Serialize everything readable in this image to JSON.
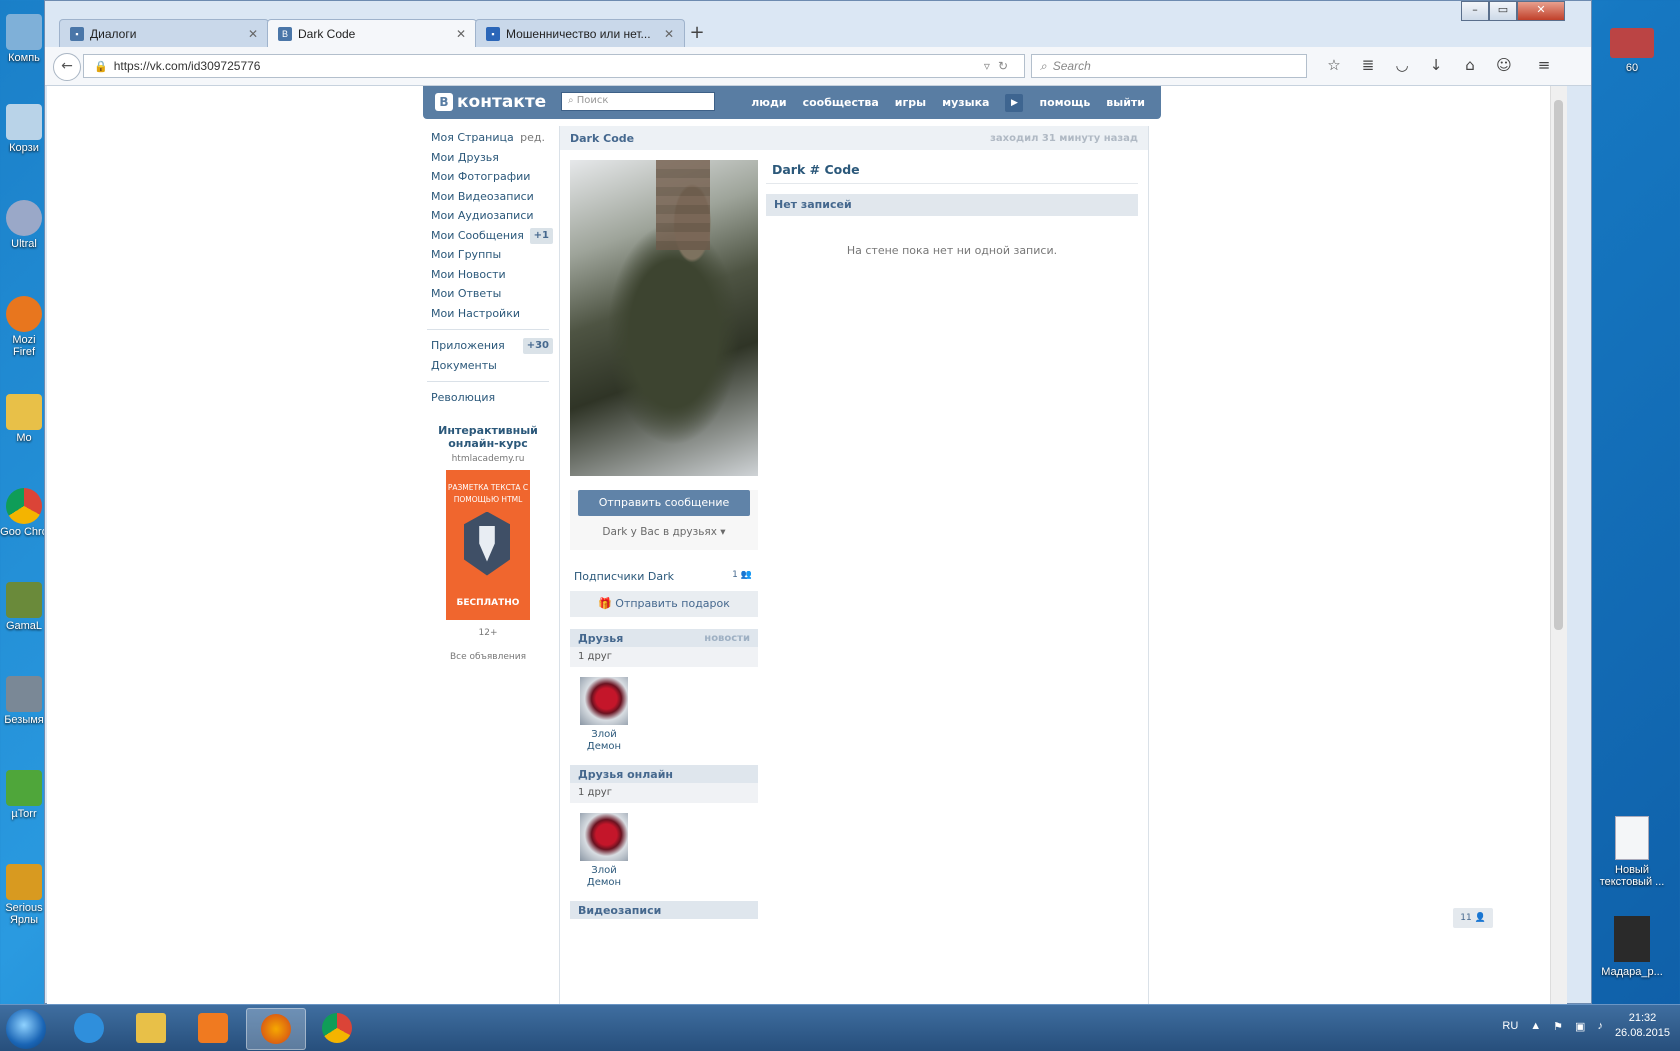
{
  "desktop": {
    "left_icons": [
      "Компь",
      "Корзи",
      "Ultral",
      "Mozi Firef",
      "Mo",
      "Goo Chro",
      "GamaL",
      "Безымя",
      "µTorr",
      "Serious Ярлы"
    ],
    "right_icons": [
      {
        "label": "60"
      },
      {
        "label": "Новый текстовый ..."
      },
      {
        "label": "Мадара_р..."
      }
    ]
  },
  "browser": {
    "tabs": [
      {
        "title": "Диалоги",
        "active": false
      },
      {
        "title": "Dark Code",
        "active": true
      },
      {
        "title": "Мошенничество или нет...",
        "active": false
      }
    ],
    "url": "https://vk.com/id309725776",
    "search_placeholder": "Search"
  },
  "vk": {
    "logo": "контакте",
    "search_placeholder": "Поиск",
    "nav": [
      "люди",
      "сообщества",
      "игры",
      "музыка",
      "помощь",
      "выйти"
    ],
    "menu": [
      {
        "label": "Моя Страница",
        "aux": "ред."
      },
      {
        "label": "Мои Друзья"
      },
      {
        "label": "Мои Фотографии"
      },
      {
        "label": "Мои Видеозаписи"
      },
      {
        "label": "Мои Аудиозаписи"
      },
      {
        "label": "Мои Сообщения",
        "count": "+1"
      },
      {
        "label": "Мои Группы"
      },
      {
        "label": "Мои Новости"
      },
      {
        "label": "Мои Ответы"
      },
      {
        "label": "Мои Настройки"
      },
      {
        "label": "Приложения",
        "count": "+30"
      },
      {
        "label": "Документы"
      },
      {
        "label": "Революция"
      }
    ],
    "ad": {
      "title": "Интерактивный онлайн-курс",
      "url": "htmlacademy.ru",
      "image_text": "РАЗМЕТКА ТЕКСТА С ПОМОЩЬЮ HTML",
      "free": "БЕСПЛАТНО",
      "age": "12+",
      "all": "Все объявления"
    },
    "profile": {
      "header_name": "Dark Code",
      "last_seen": "заходил 31 минуту назад",
      "full_name": "Dark # Code",
      "send_message": "Отправить сообщение",
      "friend_state": "Dark у Вас в друзьях",
      "subscribers_label": "Подписчики Dark",
      "subscribers_count": "1",
      "gift": "Отправить подарок",
      "friends": {
        "title": "Друзья",
        "aux": "новости",
        "count": "1 друг",
        "items": [
          {
            "name": "Злой Демон"
          }
        ]
      },
      "friends_online": {
        "title": "Друзья онлайн",
        "count": "1 друг",
        "items": [
          {
            "name": "Злой Демон"
          }
        ]
      },
      "videos_title": "Видеозаписи",
      "wall_header": "Нет записей",
      "wall_empty": "На стене пока нет ни одной записи."
    },
    "corner_badge": "11"
  },
  "taskbar": {
    "lang": "RU",
    "time": "21:32",
    "date": "26.08.2015"
  }
}
